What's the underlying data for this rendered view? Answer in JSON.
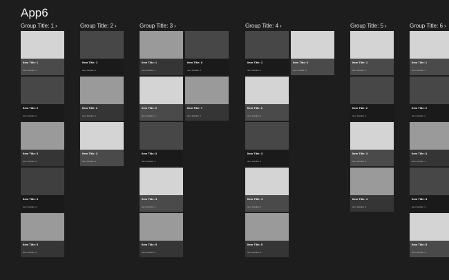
{
  "app": {
    "title": "App6"
  },
  "groups": [
    {
      "title": "Group Title: 1",
      "chevron": "›",
      "columns": [
        [
          {
            "title": "Item Title: 1",
            "subtitle": "Item Subtitle: 1",
            "img": "#d4d4d4",
            "overlay": "#4a4a4a"
          },
          {
            "title": "Item Title: 2",
            "subtitle": "Item Subtitle: 2",
            "img": "#474747",
            "overlay": "#1a1a1a"
          },
          {
            "title": "Item Title: 3",
            "subtitle": "Item Subtitle: 3",
            "img": "#9a9a9a",
            "overlay": "#353535"
          },
          {
            "title": "Item Title: 4",
            "subtitle": "Item Subtitle: 4",
            "img": "#3f3f3f",
            "overlay": "#1a1a1a"
          },
          {
            "title": "Item Title: 5",
            "subtitle": "Item Subtitle: 5",
            "img": "#9a9a9a",
            "overlay": "#353535"
          }
        ]
      ]
    },
    {
      "title": "Group Title: 2",
      "chevron": "›",
      "columns": [
        [
          {
            "title": "Item Title: 1",
            "subtitle": "Item Subtitle: 1",
            "img": "#474747",
            "overlay": "#1a1a1a"
          },
          {
            "title": "Item Title: 2",
            "subtitle": "Item Subtitle: 2",
            "img": "#9a9a9a",
            "overlay": "#353535"
          },
          {
            "title": "Item Title: 3",
            "subtitle": "Item Subtitle: 3",
            "img": "#d4d4d4",
            "overlay": "#4a4a4a"
          }
        ]
      ]
    },
    {
      "title": "Group Title: 3",
      "chevron": "›",
      "columns": [
        [
          {
            "title": "Item Title: 1",
            "subtitle": "Item Subtitle: 1",
            "img": "#9a9a9a",
            "overlay": "#353535"
          },
          {
            "title": "Item Title: 2",
            "subtitle": "Item Subtitle: 2",
            "img": "#d4d4d4",
            "overlay": "#4a4a4a"
          },
          {
            "title": "Item Title: 3",
            "subtitle": "Item Subtitle: 3",
            "img": "#474747",
            "overlay": "#1a1a1a"
          },
          {
            "title": "Item Title: 4",
            "subtitle": "Item Subtitle: 4",
            "img": "#d4d4d4",
            "overlay": "#4a4a4a"
          },
          {
            "title": "Item Title: 5",
            "subtitle": "Item Subtitle: 5",
            "img": "#9a9a9a",
            "overlay": "#353535"
          }
        ],
        [
          {
            "title": "Item Title: 6",
            "subtitle": "Item Subtitle: 6",
            "img": "#474747",
            "overlay": "#1a1a1a"
          },
          {
            "title": "Item Title: 7",
            "subtitle": "Item Subtitle: 7",
            "img": "#9a9a9a",
            "overlay": "#353535"
          }
        ]
      ]
    },
    {
      "title": "Group Title: 4",
      "chevron": "›",
      "columns": [
        [
          {
            "title": "Item Title: 1",
            "subtitle": "Item Subtitle: 1",
            "img": "#474747",
            "overlay": "#1a1a1a"
          },
          {
            "title": "Item Title: 2",
            "subtitle": "Item Subtitle: 2",
            "img": "#d4d4d4",
            "overlay": "#4a4a4a"
          },
          {
            "title": "Item Title: 3",
            "subtitle": "Item Subtitle: 3",
            "img": "#474747",
            "overlay": "#1a1a1a"
          },
          {
            "title": "Item Title: 4",
            "subtitle": "Item Subtitle: 4",
            "img": "#d4d4d4",
            "overlay": "#4a4a4a"
          },
          {
            "title": "Item Title: 5",
            "subtitle": "Item Subtitle: 5",
            "img": "#9a9a9a",
            "overlay": "#353535"
          }
        ],
        [
          {
            "title": "Item Title: 6",
            "subtitle": "Item Subtitle: 6",
            "img": "#d4d4d4",
            "overlay": "#4a4a4a"
          }
        ]
      ]
    },
    {
      "title": "Group Title: 5",
      "chevron": "›",
      "columns": [
        [
          {
            "title": "Item Title: 1",
            "subtitle": "Item Subtitle: 1",
            "img": "#d4d4d4",
            "overlay": "#4a4a4a"
          },
          {
            "title": "Item Title: 2",
            "subtitle": "Item Subtitle: 2",
            "img": "#474747",
            "overlay": "#1a1a1a"
          },
          {
            "title": "Item Title: 3",
            "subtitle": "Item Subtitle: 3",
            "img": "#d4d4d4",
            "overlay": "#4a4a4a"
          },
          {
            "title": "Item Title: 4",
            "subtitle": "Item Subtitle: 4",
            "img": "#9a9a9a",
            "overlay": "#353535"
          }
        ]
      ]
    },
    {
      "title": "Group Title: 6",
      "chevron": "›",
      "columns": [
        [
          {
            "title": "Item Title: 1",
            "subtitle": "Item Subtitle: 1",
            "img": "#d4d4d4",
            "overlay": "#4a4a4a"
          },
          {
            "title": "Item Title: 2",
            "subtitle": "Item Subtitle: 2",
            "img": "#474747",
            "overlay": "#1a1a1a"
          },
          {
            "title": "Item Title: 3",
            "subtitle": "Item Subtitle: 3",
            "img": "#9a9a9a",
            "overlay": "#353535"
          },
          {
            "title": "Item Title: 4",
            "subtitle": "Item Subtitle: 4",
            "img": "#474747",
            "overlay": "#1a1a1a"
          },
          {
            "title": "Item Title: 5",
            "subtitle": "Item Subtitle: 5",
            "img": "#d4d4d4",
            "overlay": "#4a4a4a"
          }
        ]
      ]
    }
  ]
}
